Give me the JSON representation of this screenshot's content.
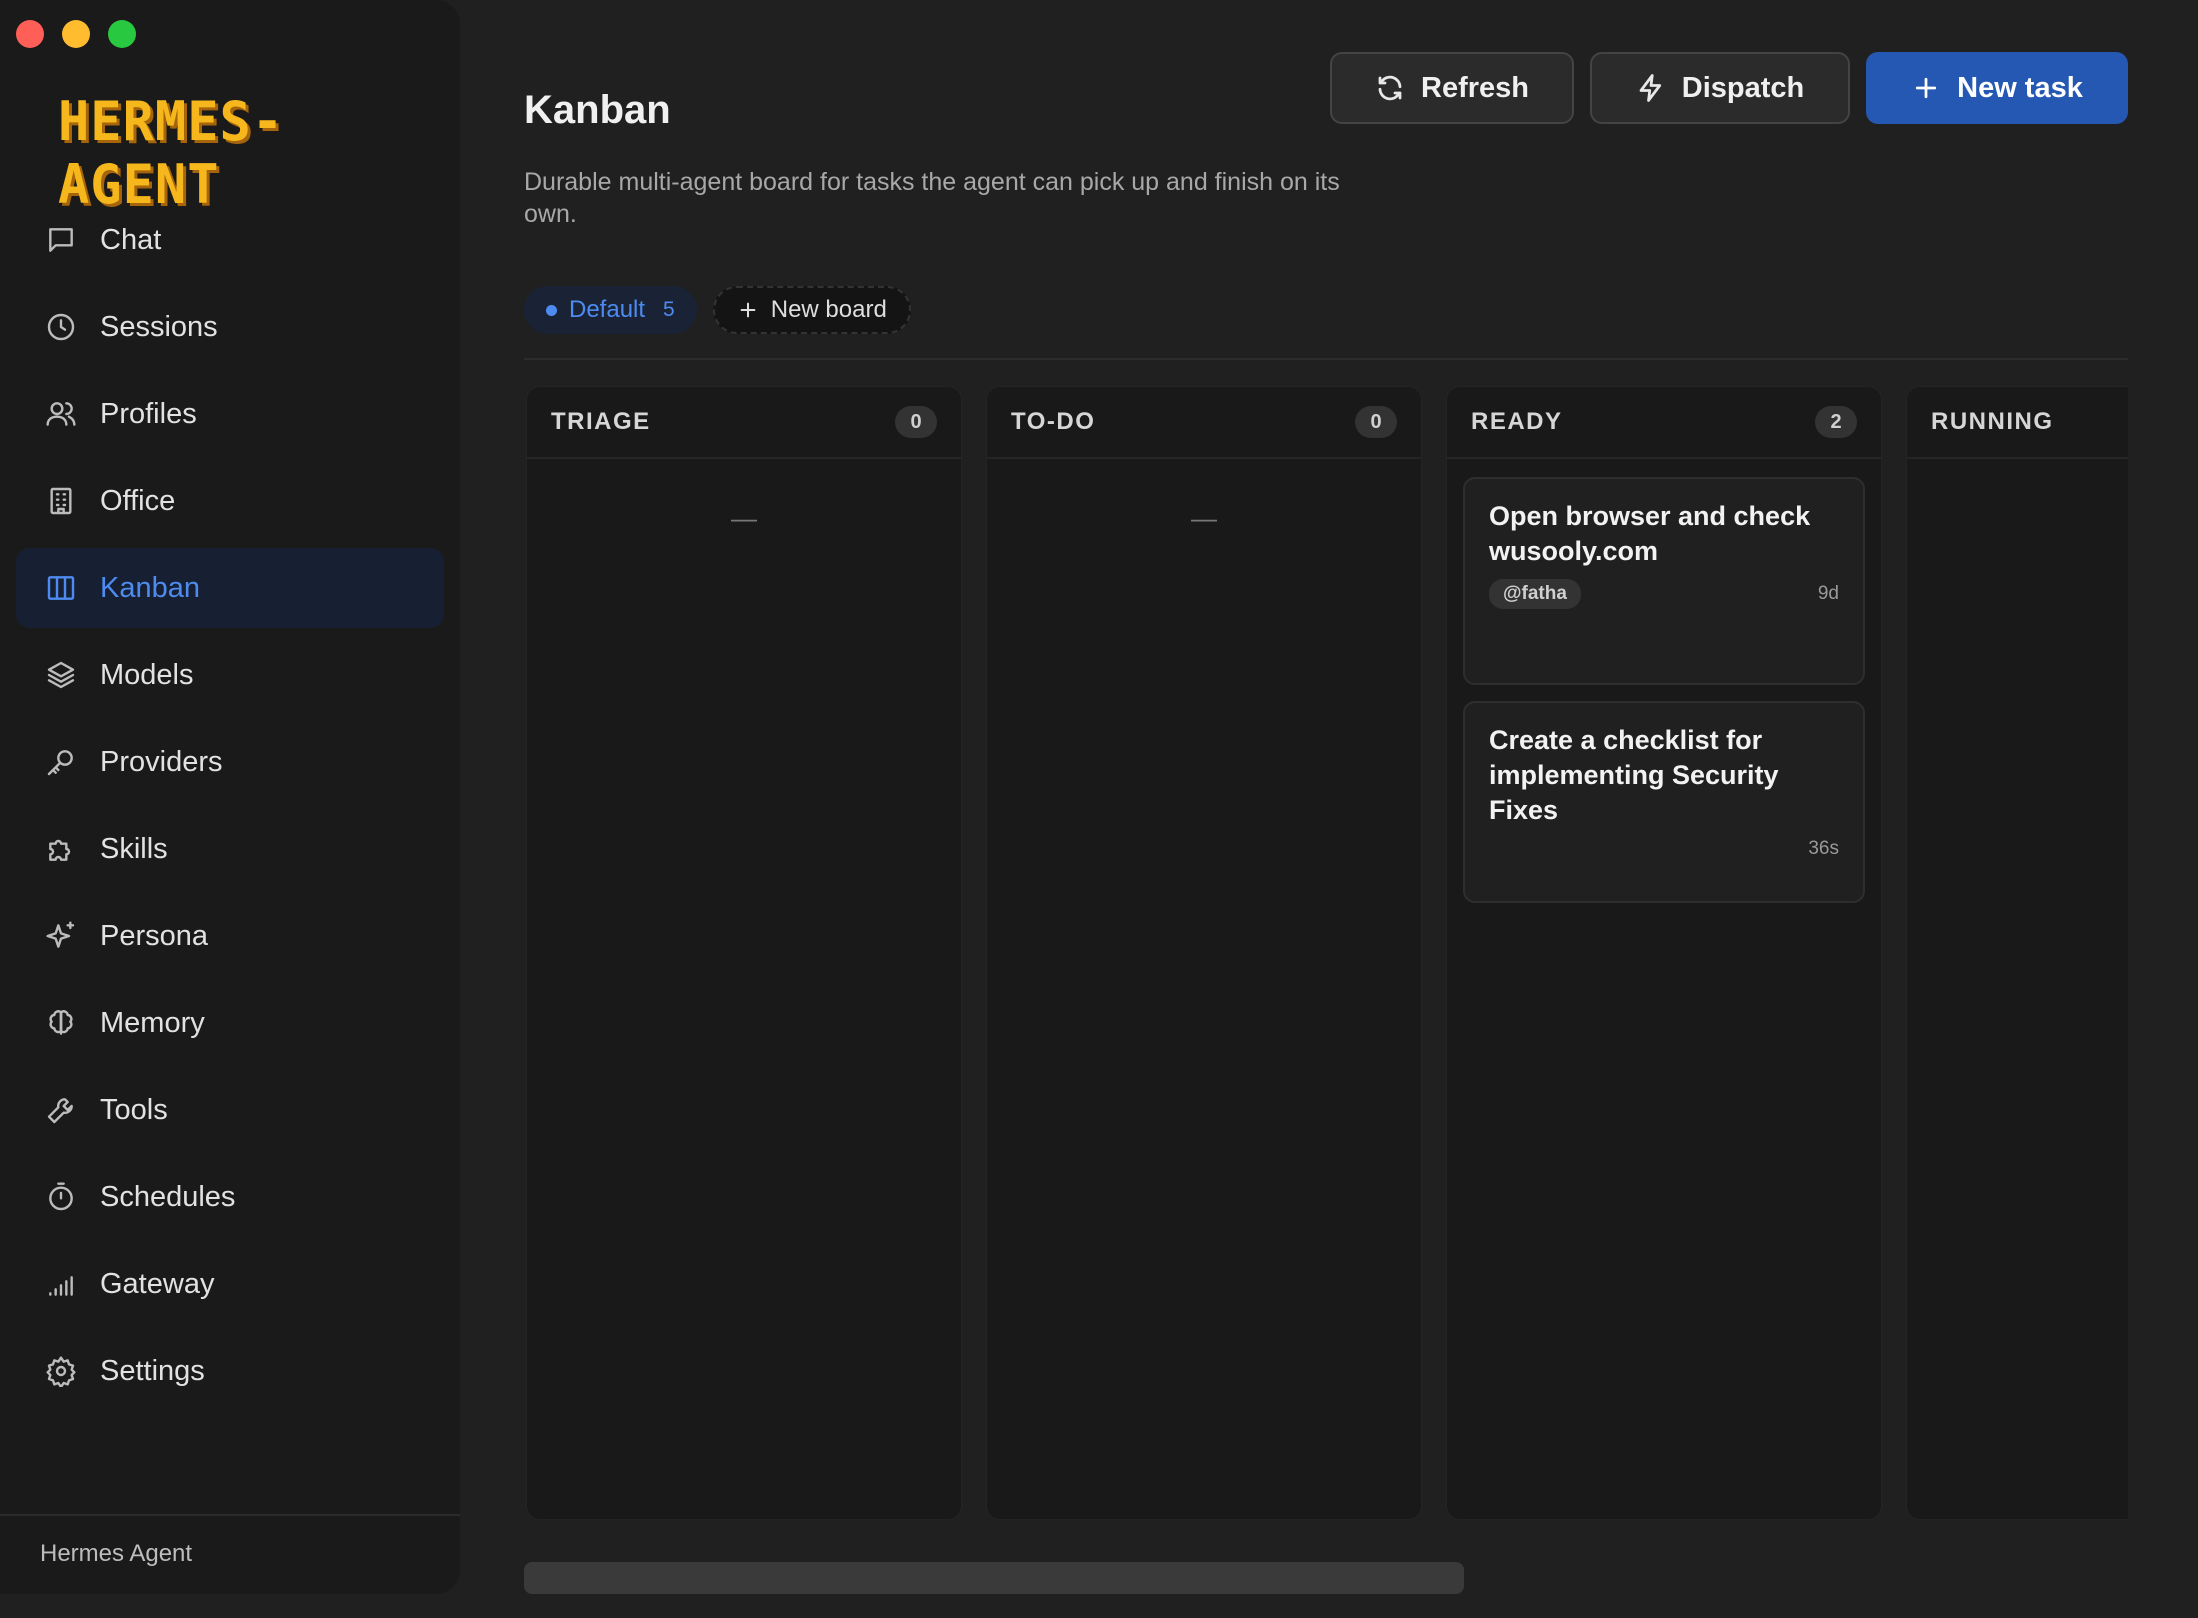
{
  "app": {
    "logo": "HERMES-AGENT",
    "footer": "Hermes Agent"
  },
  "sidebar": {
    "items": [
      {
        "label": "Chat",
        "icon": "chat-icon",
        "active": false
      },
      {
        "label": "Sessions",
        "icon": "clock-icon",
        "active": false
      },
      {
        "label": "Profiles",
        "icon": "users-icon",
        "active": false
      },
      {
        "label": "Office",
        "icon": "building-icon",
        "active": false
      },
      {
        "label": "Kanban",
        "icon": "kanban-icon",
        "active": true
      },
      {
        "label": "Models",
        "icon": "layers-icon",
        "active": false
      },
      {
        "label": "Providers",
        "icon": "key-icon",
        "active": false
      },
      {
        "label": "Skills",
        "icon": "puzzle-icon",
        "active": false
      },
      {
        "label": "Persona",
        "icon": "sparkles-icon",
        "active": false
      },
      {
        "label": "Memory",
        "icon": "brain-icon",
        "active": false
      },
      {
        "label": "Tools",
        "icon": "wrench-icon",
        "active": false
      },
      {
        "label": "Schedules",
        "icon": "timer-icon",
        "active": false
      },
      {
        "label": "Gateway",
        "icon": "signal-icon",
        "active": false
      },
      {
        "label": "Settings",
        "icon": "gear-icon",
        "active": false
      }
    ]
  },
  "header": {
    "title": "Kanban",
    "description": "Durable multi-agent board for tasks the agent can pick up and finish on its own.",
    "refresh_label": "Refresh",
    "dispatch_label": "Dispatch",
    "new_task_label": "New task"
  },
  "boards": {
    "active": {
      "name": "Default",
      "count": "5"
    },
    "new_board_label": "New board"
  },
  "columns": [
    {
      "title": "TRIAGE",
      "count": "0",
      "empty": "—",
      "cards": []
    },
    {
      "title": "TO-DO",
      "count": "0",
      "empty": "—",
      "cards": []
    },
    {
      "title": "READY",
      "count": "2",
      "cards": [
        {
          "title": "Open browser and check wusooly.com",
          "assignee": "@fatha",
          "age": "9d"
        },
        {
          "title": "Create a checklist for implementing Security Fixes",
          "assignee": "",
          "age": "36s"
        }
      ]
    },
    {
      "title": "RUNNING",
      "count": "",
      "empty": "—",
      "cards": []
    }
  ],
  "colors": {
    "accent": "#2458b3",
    "active_text": "#4d8bf0",
    "logo": "#f5b71c"
  }
}
